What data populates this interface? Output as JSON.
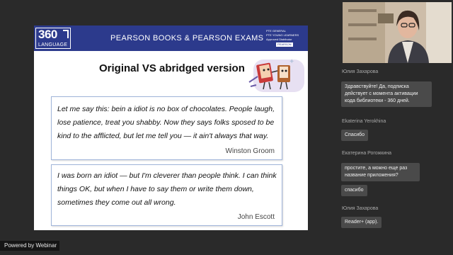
{
  "slide": {
    "logo_number": "360",
    "logo_word": "LANGUAGE",
    "header_title": "PEARSON BOOKS & PEARSON EXAMS",
    "pte_lines": [
      "PTE GENERAL",
      "PTE YOUNG LEARNERS"
    ],
    "pte_small": "Approved Distributor",
    "pte_badge": "PEARSON",
    "title": "Original VS abridged version",
    "quotes": [
      {
        "text": "Let me say this: bein a idiot is no box of chocolates. People laugh, lose patience, treat you shabby. Now they says folks sposed to be kind to the afflicted, but let me tell you — it ain't always that way.",
        "author": "Winston Groom"
      },
      {
        "text": "I was born an idiot — but I'm cleverer than people think. I can think things OK, but when I have to say them or write them down, sometimes they come out all wrong.",
        "author": "John Escott"
      }
    ]
  },
  "footer": {
    "powered_by": "Powered by Webinar"
  },
  "chat": [
    {
      "name": "Юлия Захарова",
      "message": "Здравствуйте! Да, подписка действует с момента активации кода библиотеки - 360 дней."
    },
    {
      "name": "Ekaterina Yerokhina",
      "message": "Спасибо"
    },
    {
      "name": "Екатерина Рогожкина",
      "message": "простите, а можно еще раз название приложения?"
    },
    {
      "name": "",
      "message": "спасибо"
    },
    {
      "name": "Юлия Захарова",
      "message": "Reader+ (app)."
    }
  ]
}
